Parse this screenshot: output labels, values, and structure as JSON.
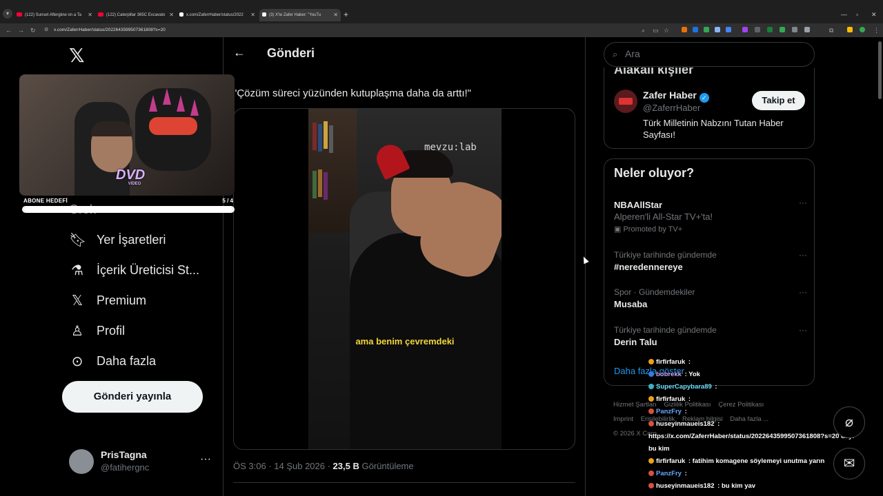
{
  "browser": {
    "tabs": [
      {
        "label": "(122) Sunset Afterglow on a Ta",
        "fav_color": "#ff0033"
      },
      {
        "label": "(122) Caterpillar 365C Excavato",
        "fav_color": "#ff0033"
      },
      {
        "label": "x.com/ZaferrHaber/status/2022",
        "fav_color": "#ffffff"
      },
      {
        "label": "(3) X'te Zafer Haber: \"YouTu",
        "fav_color": "#ffffff"
      }
    ],
    "url": "x.com/ZaferrHaber/status/2022643599507361808?s=20"
  },
  "nav": {
    "items": [
      {
        "label": "Yer İşaretleri",
        "icon": "bookmark-icon"
      },
      {
        "label": "İçerik Üreticisi St...",
        "icon": "creator-studio-icon"
      },
      {
        "label": "Premium",
        "icon": "x-premium-icon"
      },
      {
        "label": "Profil",
        "icon": "profile-icon"
      },
      {
        "label": "Daha fazla",
        "icon": "more-circle-icon"
      }
    ],
    "grok_label": "Grok",
    "post_button": "Gönderi yayınla",
    "account": {
      "name": "PrisTagna",
      "handle": "@fatihergnc"
    }
  },
  "main": {
    "title": "Gönderi",
    "tweet_text": "\"Çözüm süreci yüzünden kutuplaşma daha da arttı!\"",
    "video_brand": "mevzu:lab",
    "video_subtitle": "ama benim çevremdeki",
    "meta_time": "ÖS 3:06 · 14 Şub 2026 · ",
    "meta_views": "23,5 B",
    "meta_views_label": " Görüntüleme"
  },
  "right": {
    "search_placeholder": "Ara",
    "related": {
      "title_clip": "Alakalı kişiler",
      "name": "Zafer Haber",
      "handle": "@ZaferrHaber",
      "follow": "Takip et",
      "bio": "Türk Milletinin Nabzını Tutan Haber Sayfası!"
    },
    "trends": {
      "title": "Neler oluyor?",
      "items": [
        {
          "context": "",
          "title": "NBAAllStar",
          "sub": "Alperen'li All-Star TV+'ta!",
          "promo": "Promoted by TV+"
        },
        {
          "context": "Türkiye tarihinde gündemde",
          "title": "#neredennereye",
          "sub": "",
          "promo": ""
        },
        {
          "context": "Spor · Gündemdekiler",
          "title": "Musaba",
          "sub": "",
          "promo": ""
        },
        {
          "context": "Türkiye tarihinde gündemde",
          "title": "Derin Talu",
          "sub": "",
          "promo": ""
        }
      ],
      "show_more": "Daha fazla göster"
    },
    "footer": [
      "Hizmet Şartları",
      "Gizlilik Politikası",
      "Çerez Politikası",
      "Imprint",
      "Erişilebilirlik",
      "Reklam bilgisi",
      "Daha fazla ...",
      "© 2026 X Corp."
    ]
  },
  "overlay": {
    "goal_label": "ABONE HEDEFİ",
    "goal_count": "5 / 4",
    "goal_progress": 1.0,
    "dvd": "DVD",
    "dvd_sub": "VIDEO",
    "chat": [
      {
        "user": "firfirfaruk",
        "text": " : ",
        "color": "#ffffff",
        "badge": "#e8a317"
      },
      {
        "user": "bobrekk",
        "text": " : Yok",
        "color": "#c9a7ff",
        "badge": "#2f7ee0"
      },
      {
        "user": "SuperCapybara89",
        "text": " : ",
        "color": "#6ee0ff",
        "badge": "#3ab0c9"
      },
      {
        "user": "firfirfaruk",
        "text": " : ",
        "color": "#ffffff",
        "badge": "#e8a317"
      },
      {
        "user": "PanzFry",
        "text": " : ",
        "color": "#6aa8ff",
        "badge": "#d8523a"
      },
      {
        "user": "huseyinmaueis182",
        "text": " : ",
        "color": "#ffffff",
        "badge": "#d8523a"
      },
      {
        "user": "",
        "text": "https://x.com/ZaferrHaber/status/2022643599507361808?s=20 dayı",
        "color": "#ffffff",
        "badge": ""
      },
      {
        "user": "",
        "text": "bu kim",
        "color": "#ffffff",
        "badge": ""
      },
      {
        "user": "firfirfaruk",
        "text": " : fatihim komagene söylemeyi unutma yarın",
        "color": "#ffffff",
        "badge": "#e8a317"
      },
      {
        "user": "PanzFry",
        "text": " : ",
        "color": "#6aa8ff",
        "badge": "#d8523a"
      },
      {
        "user": "huseyinmaueis182",
        "text": " : bu kim yav",
        "color": "#ffffff",
        "badge": "#d8523a"
      }
    ]
  }
}
